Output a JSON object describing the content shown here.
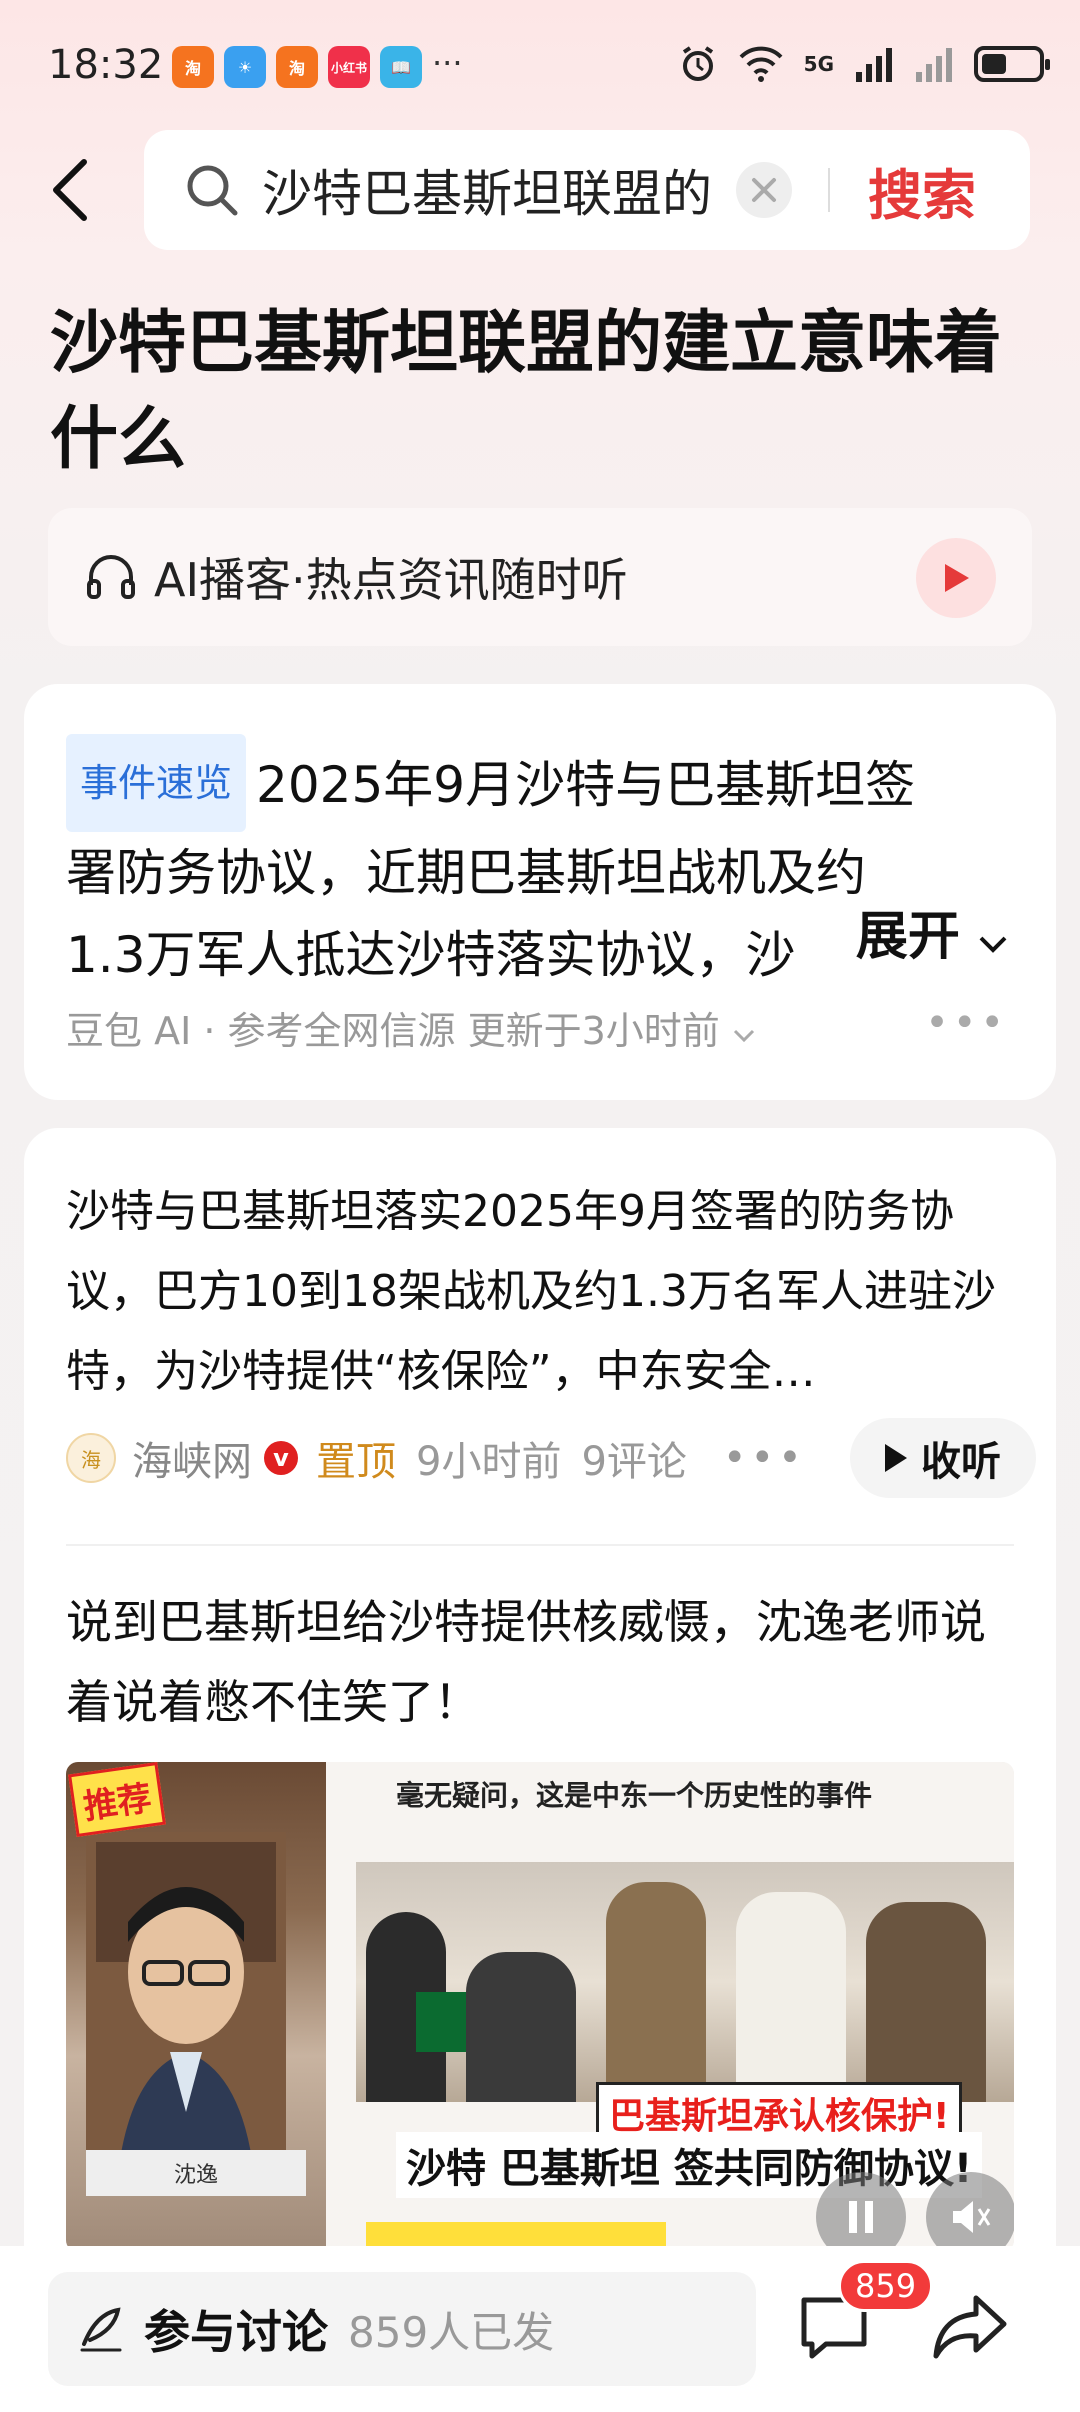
{
  "status": {
    "time": "18:32",
    "app_icons": [
      {
        "name": "taobao-app-icon",
        "color": "#f5731f",
        "glyph": "淘"
      },
      {
        "name": "weather-app-icon",
        "color": "#3aa0f0",
        "glyph": "☀"
      },
      {
        "name": "taobao-app-icon-2",
        "color": "#f5731f",
        "glyph": "淘"
      },
      {
        "name": "xiaohongshu-app-icon",
        "color": "#f0304a",
        "glyph": "小红书"
      },
      {
        "name": "reader-app-icon",
        "color": "#3ab4e8",
        "glyph": "📖"
      }
    ],
    "more": "···",
    "network": "5G"
  },
  "header": {
    "search_text": "沙特巴基斯坦联盟的",
    "search_button": "搜索"
  },
  "page": {
    "title": "沙特巴基斯坦联盟的建立意味着什么"
  },
  "podcast": {
    "label": "AI播客·热点资讯随时听"
  },
  "summary_card": {
    "tag": "事件速览",
    "line1": "2025年9月沙特与巴基斯坦签",
    "line2": "署防务协议，近期巴基斯坦战机及约",
    "line3": "1.3万军人抵达沙特落实协议，沙",
    "expand": "展开",
    "meta": "豆包 AI · 参考全网信源 更新于3小时前"
  },
  "news_card": {
    "article1": "沙特与巴基斯坦落实2025年9月签署的防务协议，巴方10到18架战机及约1.3万名军人进驻沙特，为沙特提供“核保险”，中东安全…",
    "source_name": "海峡网",
    "pin_label": "置顶",
    "time": "9小时前",
    "comments": "9评论",
    "listen_label": "收听",
    "article2": "说到巴基斯坦给沙特提供核威慑，沈逸老师说着说着憋不住笑了！",
    "video": {
      "badge": "推荐",
      "name_plate": "沈逸",
      "caption": "毫无疑问，这是中东一个历史性的事件",
      "red_banner": "巴基斯坦承认核保护!",
      "white_banner": "沙特 巴基斯坦 签共同防御协议!"
    }
  },
  "bottom_bar": {
    "discuss_label": "参与讨论",
    "discuss_count": "859人已发",
    "comment_badge": "859"
  },
  "colors": {
    "accent": "#e53a3a",
    "tag_blue": "#2a6fd8",
    "pin_orange": "#d08a1c"
  }
}
